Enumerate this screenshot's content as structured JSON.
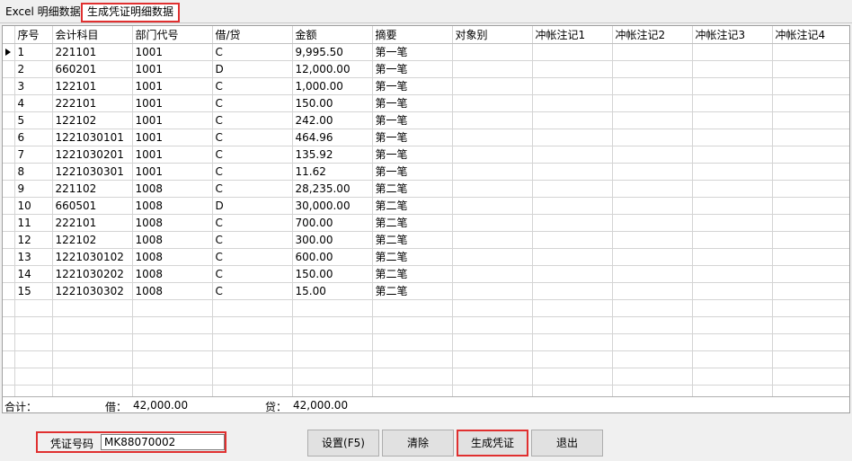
{
  "tabs": [
    {
      "label": "Excel 明细数据"
    },
    {
      "label": "生成凭证明细数据"
    }
  ],
  "grid": {
    "headers": [
      "序号",
      "会计科目",
      "部门代号",
      "借/贷",
      "金额",
      "摘要",
      "对象别",
      "冲帐注记1",
      "冲帐注记2",
      "冲帐注记3",
      "冲帐注记4"
    ],
    "rows": [
      {
        "no": "1",
        "account": "221101",
        "dept": "1001",
        "dc": "C",
        "amount": "9,995.50",
        "summary": "第一笔"
      },
      {
        "no": "2",
        "account": "660201",
        "dept": "1001",
        "dc": "D",
        "amount": "12,000.00",
        "summary": "第一笔"
      },
      {
        "no": "3",
        "account": "122101",
        "dept": "1001",
        "dc": "C",
        "amount": "1,000.00",
        "summary": "第一笔"
      },
      {
        "no": "4",
        "account": "222101",
        "dept": "1001",
        "dc": "C",
        "amount": "150.00",
        "summary": "第一笔"
      },
      {
        "no": "5",
        "account": "122102",
        "dept": "1001",
        "dc": "C",
        "amount": "242.00",
        "summary": "第一笔"
      },
      {
        "no": "6",
        "account": "1221030101",
        "dept": "1001",
        "dc": "C",
        "amount": "464.96",
        "summary": "第一笔"
      },
      {
        "no": "7",
        "account": "1221030201",
        "dept": "1001",
        "dc": "C",
        "amount": "135.92",
        "summary": "第一笔"
      },
      {
        "no": "8",
        "account": "1221030301",
        "dept": "1001",
        "dc": "C",
        "amount": "11.62",
        "summary": "第一笔"
      },
      {
        "no": "9",
        "account": "221102",
        "dept": "1008",
        "dc": "C",
        "amount": "28,235.00",
        "summary": "第二笔"
      },
      {
        "no": "10",
        "account": "660501",
        "dept": "1008",
        "dc": "D",
        "amount": "30,000.00",
        "summary": "第二笔"
      },
      {
        "no": "11",
        "account": "222101",
        "dept": "1008",
        "dc": "C",
        "amount": "700.00",
        "summary": "第二笔"
      },
      {
        "no": "12",
        "account": "122102",
        "dept": "1008",
        "dc": "C",
        "amount": "300.00",
        "summary": "第二笔"
      },
      {
        "no": "13",
        "account": "1221030102",
        "dept": "1008",
        "dc": "C",
        "amount": "600.00",
        "summary": "第二笔"
      },
      {
        "no": "14",
        "account": "1221030202",
        "dept": "1008",
        "dc": "C",
        "amount": "150.00",
        "summary": "第二笔"
      },
      {
        "no": "15",
        "account": "1221030302",
        "dept": "1008",
        "dc": "C",
        "amount": "15.00",
        "summary": "第二笔"
      }
    ]
  },
  "totals": {
    "label": "合计：",
    "debit_label": "借：",
    "debit_value": "42,000.00",
    "credit_label": "贷：",
    "credit_value": "42,000.00"
  },
  "voucher": {
    "label": "凭证号码",
    "value": "MK88070002"
  },
  "buttons": {
    "settings": "设置(F5)",
    "clear": "清除",
    "generate": "生成凭证",
    "exit": "退出"
  }
}
